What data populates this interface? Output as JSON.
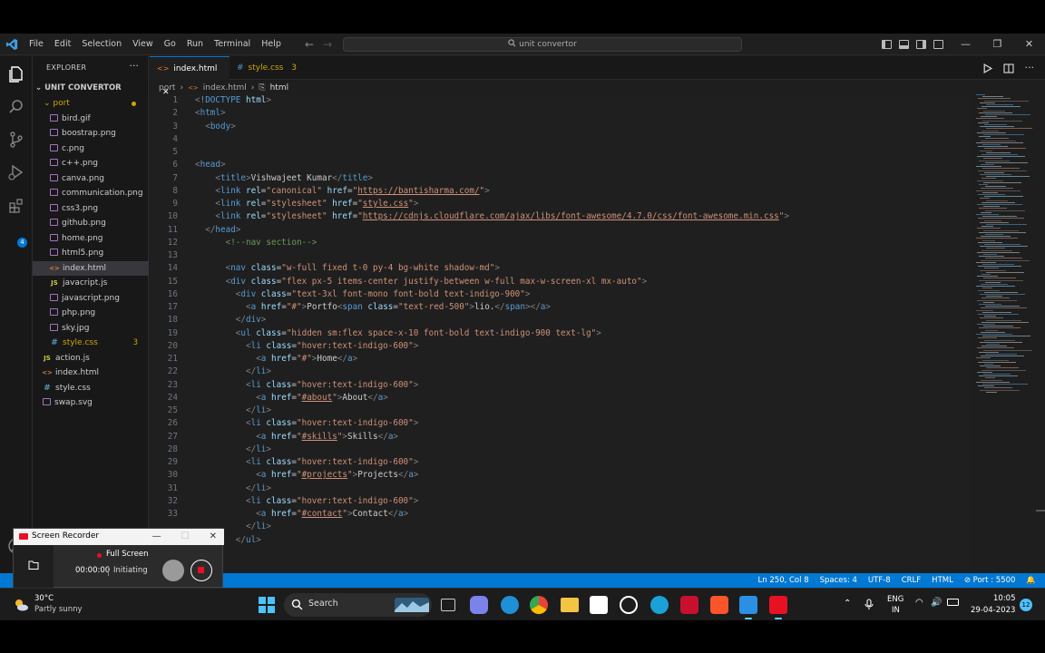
{
  "titlebar": {
    "menu": [
      "File",
      "Edit",
      "Selection",
      "View",
      "Go",
      "Run",
      "Terminal",
      "Help"
    ],
    "search_text": "unit convertor",
    "nav_back": "←",
    "nav_forward": "→",
    "minimize": "—",
    "maximize": "❐",
    "close": "✕"
  },
  "sidebar": {
    "title": "EXPLORER",
    "more": "···",
    "root": "UNIT CONVERTOR",
    "folder": "port",
    "port_files": [
      {
        "name": "bird.gif",
        "type": "img"
      },
      {
        "name": "boostrap.png",
        "type": "img"
      },
      {
        "name": "c.png",
        "type": "img"
      },
      {
        "name": "c++.png",
        "type": "img"
      },
      {
        "name": "canva.png",
        "type": "img"
      },
      {
        "name": "communication.png",
        "type": "img"
      },
      {
        "name": "css3.png",
        "type": "img"
      },
      {
        "name": "github.png",
        "type": "img"
      },
      {
        "name": "home.png",
        "type": "img"
      },
      {
        "name": "html5.png",
        "type": "img"
      },
      {
        "name": "index.html",
        "type": "html"
      },
      {
        "name": "javacript.js",
        "type": "js"
      },
      {
        "name": "javascript.png",
        "type": "img"
      },
      {
        "name": "php.png",
        "type": "img"
      },
      {
        "name": "sky.jpg",
        "type": "img"
      },
      {
        "name": "style.css",
        "type": "css",
        "badge": "3"
      }
    ],
    "root_files": [
      {
        "name": "action.js",
        "type": "js"
      },
      {
        "name": "index.html",
        "type": "html"
      },
      {
        "name": "style.css",
        "type": "css"
      },
      {
        "name": "swap.svg",
        "type": "img"
      }
    ],
    "extensions_badge": "4"
  },
  "tabs": [
    {
      "label": "index.html",
      "close": "✕"
    },
    {
      "label": "style.css",
      "badge": "3"
    }
  ],
  "breadcrumb": [
    "port",
    "index.html",
    "html"
  ],
  "code_lines": [
    {
      "n": "1",
      "html": "<span class=\"br\">&lt;</span><span class=\"t\">!DOCTYPE</span> <span class=\"a\">html</span><span class=\"br\">&gt;</span>"
    },
    {
      "n": "2",
      "html": "<span class=\"br\">&lt;</span><span class=\"t\">html</span><span class=\"br\">&gt;</span>"
    },
    {
      "n": "3",
      "html": "  <span class=\"br\">&lt;</span><span class=\"t\">body</span><span class=\"br\">&gt;</span>"
    },
    {
      "n": "4",
      "html": ""
    },
    {
      "n": "5",
      "html": ""
    },
    {
      "n": "6",
      "html": "<span class=\"br\">&lt;</span><span class=\"t\">head</span><span class=\"br\">&gt;</span>"
    },
    {
      "n": "7",
      "html": "    <span class=\"br\">&lt;</span><span class=\"t\">title</span><span class=\"br\">&gt;</span>Vishwajeet Kumar<span class=\"br\">&lt;/</span><span class=\"t\">title</span><span class=\"br\">&gt;</span>"
    },
    {
      "n": "8",
      "html": "    <span class=\"br\">&lt;</span><span class=\"t\">link</span> <span class=\"a\">rel</span>=<span class=\"s\">\"canonical\"</span> <span class=\"a\">href</span>=<span class=\"s\">\"</span><span class=\"u\">https://bantisharma.com/</span><span class=\"s\">\"</span><span class=\"br\">&gt;</span>"
    },
    {
      "n": "9",
      "html": "    <span class=\"br\">&lt;</span><span class=\"t\">link</span> <span class=\"a\">rel</span>=<span class=\"s\">\"stylesheet\"</span> <span class=\"a\">href</span>=<span class=\"s\">\"</span><span class=\"u\">style.css</span><span class=\"s\">\"</span><span class=\"br\">&gt;</span>"
    },
    {
      "n": "10",
      "html": "    <span class=\"br\">&lt;</span><span class=\"t\">link</span> <span class=\"a\">rel</span>=<span class=\"s\">\"stylesheet\"</span> <span class=\"a\">href</span>=<span class=\"s\">\"</span><span class=\"u\">https://cdnjs.cloudflare.com/ajax/libs/font-awesome/4.7.0/css/font-awesome.min.css</span><span class=\"s\">\"</span><span class=\"br\">&gt;</span>"
    },
    {
      "n": "11",
      "html": "  <span class=\"br\">&lt;/</span><span class=\"t\">head</span><span class=\"br\">&gt;</span>"
    },
    {
      "n": "12",
      "html": "      <span class=\"c\">&lt;!--nav section--&gt;</span>"
    },
    {
      "n": "13",
      "html": ""
    },
    {
      "n": "14",
      "html": "      <span class=\"br\">&lt;</span><span class=\"t\">nav</span> <span class=\"a\">class</span>=<span class=\"s\">\"w-full fixed t-0 py-4 bg-white shadow-md\"</span><span class=\"br\">&gt;</span>"
    },
    {
      "n": "15",
      "html": "      <span class=\"br\">&lt;</span><span class=\"t\">div</span> <span class=\"a\">class</span>=<span class=\"s\">\"flex px-5 items-center justify-between w-full max-w-screen-xl mx-auto\"</span><span class=\"br\">&gt;</span>"
    },
    {
      "n": "16",
      "html": "        <span class=\"br\">&lt;</span><span class=\"t\">div</span> <span class=\"a\">class</span>=<span class=\"s\">\"text-3xl font-mono font-bold text-indigo-900\"</span><span class=\"br\">&gt;</span>"
    },
    {
      "n": "17",
      "html": "          <span class=\"br\">&lt;</span><span class=\"t\">a</span> <span class=\"a\">href</span>=<span class=\"s\">\"#\"</span><span class=\"br\">&gt;</span>Portfo<span class=\"br\">&lt;</span><span class=\"t\">span</span> <span class=\"a\">class</span>=<span class=\"s\">\"text-red-500\"</span><span class=\"br\">&gt;</span>lio.<span class=\"br\">&lt;/</span><span class=\"t\">span</span><span class=\"br\">&gt;&lt;/</span><span class=\"t\">a</span><span class=\"br\">&gt;</span>"
    },
    {
      "n": "18",
      "html": "        <span class=\"br\">&lt;/</span><span class=\"t\">div</span><span class=\"br\">&gt;</span>"
    },
    {
      "n": "19",
      "html": "        <span class=\"br\">&lt;</span><span class=\"t\">ul</span> <span class=\"a\">class</span>=<span class=\"s\">\"hidden sm:flex space-x-10 font-bold text-indigo-900 text-lg\"</span><span class=\"br\">&gt;</span>"
    },
    {
      "n": "20",
      "html": "          <span class=\"br\">&lt;</span><span class=\"t\">li</span> <span class=\"a\">class</span>=<span class=\"s\">\"hover:text-indigo-600\"</span><span class=\"br\">&gt;</span>"
    },
    {
      "n": "21",
      "html": "            <span class=\"br\">&lt;</span><span class=\"t\">a</span> <span class=\"a\">href</span>=<span class=\"s\">\"#\"</span><span class=\"br\">&gt;</span>Home<span class=\"br\">&lt;/</span><span class=\"t\">a</span><span class=\"br\">&gt;</span>"
    },
    {
      "n": "22",
      "html": "          <span class=\"br\">&lt;/</span><span class=\"t\">li</span><span class=\"br\">&gt;</span>"
    },
    {
      "n": "23",
      "html": "          <span class=\"br\">&lt;</span><span class=\"t\">li</span> <span class=\"a\">class</span>=<span class=\"s\">\"hover:text-indigo-600\"</span><span class=\"br\">&gt;</span>"
    },
    {
      "n": "24",
      "html": "            <span class=\"br\">&lt;</span><span class=\"t\">a</span> <span class=\"a\">href</span>=<span class=\"s\">\"</span><span class=\"u\">#about</span><span class=\"s\">\"</span><span class=\"br\">&gt;</span>About<span class=\"br\">&lt;/</span><span class=\"t\">a</span><span class=\"br\">&gt;</span>"
    },
    {
      "n": "25",
      "html": "          <span class=\"br\">&lt;/</span><span class=\"t\">li</span><span class=\"br\">&gt;</span>"
    },
    {
      "n": "26",
      "html": "          <span class=\"br\">&lt;</span><span class=\"t\">li</span> <span class=\"a\">class</span>=<span class=\"s\">\"hover:text-indigo-600\"</span><span class=\"br\">&gt;</span>"
    },
    {
      "n": "27",
      "html": "            <span class=\"br\">&lt;</span><span class=\"t\">a</span> <span class=\"a\">href</span>=<span class=\"s\">\"</span><span class=\"u\">#skills</span><span class=\"s\">\"</span><span class=\"br\">&gt;</span>Skills<span class=\"br\">&lt;/</span><span class=\"t\">a</span><span class=\"br\">&gt;</span>"
    },
    {
      "n": "28",
      "html": "          <span class=\"br\">&lt;/</span><span class=\"t\">li</span><span class=\"br\">&gt;</span>"
    },
    {
      "n": "29",
      "html": "          <span class=\"br\">&lt;</span><span class=\"t\">li</span> <span class=\"a\">class</span>=<span class=\"s\">\"hover:text-indigo-600\"</span><span class=\"br\">&gt;</span>"
    },
    {
      "n": "30",
      "html": "            <span class=\"br\">&lt;</span><span class=\"t\">a</span> <span class=\"a\">href</span>=<span class=\"s\">\"</span><span class=\"u\">#projects</span><span class=\"s\">\"</span><span class=\"br\">&gt;</span>Projects<span class=\"br\">&lt;/</span><span class=\"t\">a</span><span class=\"br\">&gt;</span>"
    },
    {
      "n": "31",
      "html": "          <span class=\"br\">&lt;/</span><span class=\"t\">li</span><span class=\"br\">&gt;</span>"
    },
    {
      "n": "32",
      "html": "          <span class=\"br\">&lt;</span><span class=\"t\">li</span> <span class=\"a\">class</span>=<span class=\"s\">\"hover:text-indigo-600\"</span><span class=\"br\">&gt;</span>"
    },
    {
      "n": "33",
      "html": "            <span class=\"br\">&lt;</span><span class=\"t\">a</span> <span class=\"a\">href</span>=<span class=\"s\">\"</span><span class=\"u\">#contact</span><span class=\"s\">\"</span><span class=\"br\">&gt;</span>Contact<span class=\"br\">&lt;/</span><span class=\"t\">a</span><span class=\"br\">&gt;</span>"
    },
    {
      "n": "",
      "html": "          <span class=\"br\">&lt;/</span><span class=\"t\">li</span><span class=\"br\">&gt;</span>"
    },
    {
      "n": "",
      "html": "        <span class=\"br\">&lt;/</span><span class=\"t\">ul</span><span class=\"br\">&gt;</span>"
    }
  ],
  "statusbar": {
    "position": "Ln 250, Col 8",
    "spaces": "Spaces: 4",
    "encoding": "UTF-8",
    "eol": "CRLF",
    "language": "HTML",
    "port": "Port : 5500"
  },
  "recorder": {
    "title": "Screen Recorder",
    "minimize": "—",
    "maximize": "☐",
    "close": "✕",
    "mode": "Full Screen",
    "time": "00:00:00",
    "state": "Initiating"
  },
  "taskbar": {
    "temp": "30°C",
    "weather": "Partly sunny",
    "search": "Search",
    "lang_top": "ENG",
    "lang_bottom": "IN",
    "time": "10:05",
    "date": "29-04-2023",
    "notifications": "12"
  },
  "colors": {
    "accent": "#0078d4",
    "statusbar": "#0078d4",
    "warning": "#cca700"
  }
}
